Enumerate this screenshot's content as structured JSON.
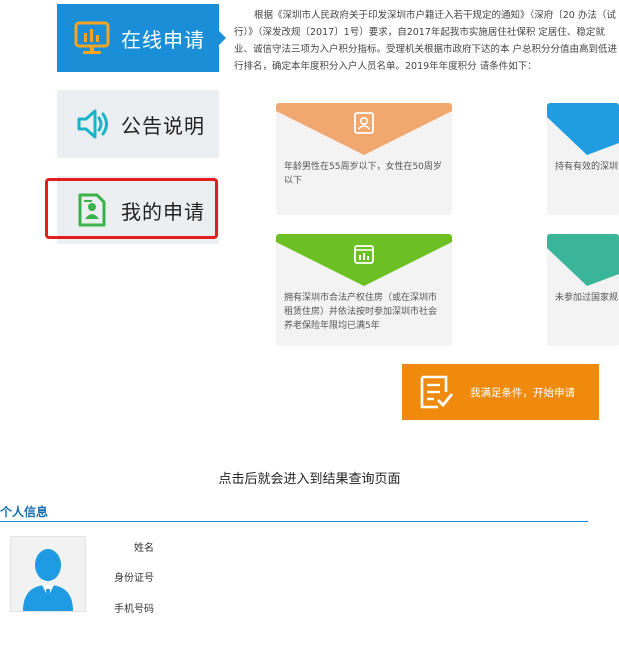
{
  "nav": {
    "online_label": "在线申请",
    "notice_label": "公告说明",
    "mine_label": "我的申请"
  },
  "intro": {
    "text": "根据《深圳市人民政府关于印发深圳市户籍迁入若干规定的通知》（深府〔20 办法（试行）》（深发改规〔2017〕1号）要求，自2017年起我市实施居住社保积 定居住、稳定就业、诚信守法三项为入户积分指标。受理机关根据市政府下达的本 户总积分分值由高到低进行排名，确定本年度积分入户人员名单。2019年年度积分 请条件如下："
  },
  "cards": [
    {
      "text": "年龄男性在55周岁以下，女性在50周岁以下",
      "color": "#f0a86e",
      "icon": "id-card-icon"
    },
    {
      "text": "持有有效的深圳",
      "color": "#1f9de0",
      "icon": "residence-permit-icon"
    },
    {
      "text": "拥有深圳市合法产权住房（或在深圳市租赁住房）并依法按时参加深圳市社会养老保险年限均已满5年",
      "color": "#6cc024",
      "icon": "house-chart-icon"
    },
    {
      "text": "未参加过国家规",
      "color": "#3ab59a",
      "icon": "certificate-icon"
    }
  ],
  "start_button": {
    "label": "我满足条件，开始申请",
    "icon": "checklist-icon"
  },
  "caption": "点击后就会进入到结果查询页面",
  "personal": {
    "title": "个人信息",
    "fields": [
      {
        "label": "姓名"
      },
      {
        "label": "身份证号"
      },
      {
        "label": "手机号码"
      }
    ]
  },
  "colors": {
    "nav_active": "#1a8fd8",
    "highlight": "#e0201f",
    "start_button": "#f08a0c"
  }
}
